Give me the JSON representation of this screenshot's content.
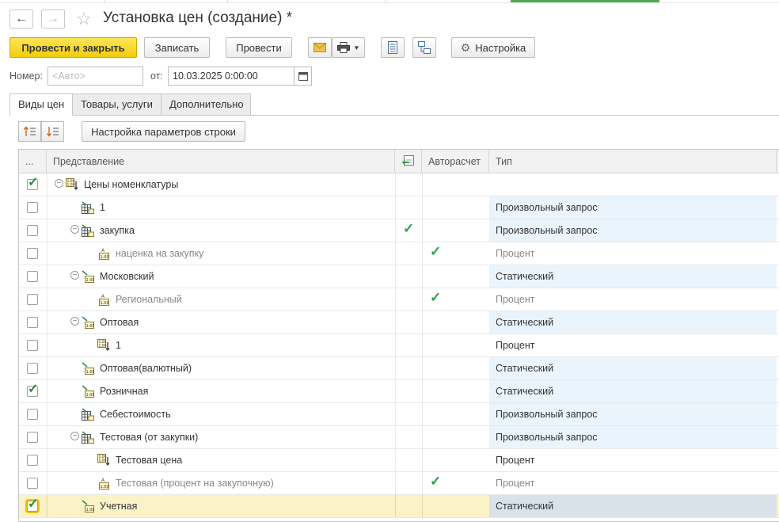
{
  "window": {
    "title": "Установка цен (создание) *"
  },
  "toolbar": {
    "post_close_label": "Провести и закрыть",
    "save_label": "Записать",
    "post_label": "Провести",
    "settings_label": "Настройка"
  },
  "form": {
    "number_label": "Номер:",
    "number_placeholder": "<Авто>",
    "date_label": "от:",
    "date_value": "10.03.2025  0:00:00"
  },
  "tabs": [
    {
      "label": "Виды цен",
      "active": true
    },
    {
      "label": "Товары, услуги",
      "active": false
    },
    {
      "label": "Дополнительно",
      "active": false
    }
  ],
  "grid_toolbar": {
    "row_settings_label": "Настройка параметров строки"
  },
  "grid": {
    "headers": {
      "dots": "...",
      "name": "Представление",
      "auto": "Авторасчет",
      "type": "Тип"
    },
    "rows": [
      {
        "checked": true,
        "name": "Цены номенклатуры",
        "type": "",
        "icon": "group-icon",
        "indent": 0,
        "tree": true,
        "link": false,
        "auto": false,
        "grey": false
      },
      {
        "checked": false,
        "name": "1",
        "type": "Произвольный запрос",
        "icon": "query-icon",
        "indent": 1,
        "tree": false,
        "link": false,
        "auto": false,
        "grey": false
      },
      {
        "checked": false,
        "name": "закупка",
        "type": "Произвольный запрос",
        "icon": "query-icon",
        "indent": 1,
        "tree": true,
        "link": true,
        "auto": false,
        "grey": false
      },
      {
        "checked": false,
        "name": "наценка на закупку",
        "type": "Процент",
        "icon": "percent-icon",
        "indent": 2,
        "tree": false,
        "link": false,
        "auto": true,
        "grey": true
      },
      {
        "checked": false,
        "name": "Московский",
        "type": "Статический",
        "icon": "static-icon",
        "indent": 1,
        "tree": true,
        "link": false,
        "auto": false,
        "grey": false
      },
      {
        "checked": false,
        "name": "Региональный",
        "type": "Процент",
        "icon": "percent-icon",
        "indent": 2,
        "tree": false,
        "link": false,
        "auto": true,
        "grey": true
      },
      {
        "checked": false,
        "name": "Оптовая",
        "type": "Статический",
        "icon": "static-icon",
        "indent": 1,
        "tree": true,
        "link": false,
        "auto": false,
        "grey": false
      },
      {
        "checked": false,
        "name": "1",
        "type": "Процент",
        "icon": "group-icon",
        "indent": 2,
        "tree": false,
        "link": false,
        "auto": false,
        "grey": false
      },
      {
        "checked": false,
        "name": "Оптовая(валютный)",
        "type": "Статический",
        "icon": "static-icon",
        "indent": 1,
        "tree": false,
        "link": false,
        "auto": false,
        "grey": false
      },
      {
        "checked": true,
        "name": "Розничная",
        "type": "Статический",
        "icon": "static-icon",
        "indent": 1,
        "tree": false,
        "link": false,
        "auto": false,
        "grey": false
      },
      {
        "checked": false,
        "name": "Себестоимость",
        "type": "Произвольный запрос",
        "icon": "query-icon",
        "indent": 1,
        "tree": false,
        "link": false,
        "auto": false,
        "grey": false
      },
      {
        "checked": false,
        "name": "Тестовая (от закупки)",
        "type": "Произвольный запрос",
        "icon": "query-icon",
        "indent": 1,
        "tree": true,
        "link": false,
        "auto": false,
        "grey": false
      },
      {
        "checked": false,
        "name": "Тестовая цена",
        "type": "Процент",
        "icon": "group-icon",
        "indent": 2,
        "tree": false,
        "link": false,
        "auto": false,
        "grey": false
      },
      {
        "checked": false,
        "name": "Тестовая (процент на закупочную)",
        "type": "Процент",
        "icon": "percent-icon",
        "indent": 2,
        "tree": false,
        "link": false,
        "auto": true,
        "grey": true
      },
      {
        "checked": true,
        "name": "Учетная",
        "type": "Статический",
        "icon": "static-icon",
        "indent": 1,
        "tree": false,
        "link": false,
        "auto": false,
        "grey": false,
        "selected": true
      }
    ]
  },
  "colors": {
    "primary_button": "#f2cd0a",
    "check_green": "#2aa049",
    "type_bg": "#eaf4fc",
    "selected_row": "#fbf2c8"
  }
}
